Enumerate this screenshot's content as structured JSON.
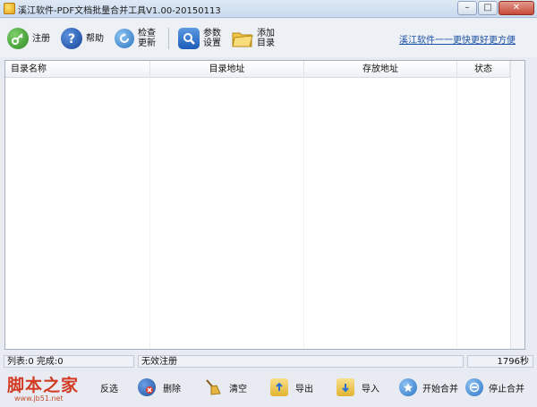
{
  "window": {
    "title": "溪江软件-PDF文档批量合并工具V1.00-20150113",
    "minimize_glyph": "–",
    "maximize_glyph": "□",
    "close_glyph": "✕"
  },
  "toolbar": {
    "buttons": [
      {
        "label": "注册",
        "icon": "key-icon"
      },
      {
        "label": "帮助",
        "icon": "help-icon"
      },
      {
        "label": "检查更新",
        "icon": "update-icon"
      },
      {
        "label": "参数设置",
        "icon": "settings-icon"
      },
      {
        "label": "添加目录",
        "icon": "folder-icon"
      }
    ],
    "link": "溪江软件一一更快更好更方便"
  },
  "table": {
    "columns": [
      "目录名称",
      "目录地址",
      "存放地址",
      "状态"
    ],
    "rows": []
  },
  "status": {
    "counts": "列表:0 完成:0",
    "registration": "无效注册",
    "timer": "1796秒"
  },
  "bottom": {
    "buttons": [
      {
        "label": "反选",
        "icon": "invert-icon"
      },
      {
        "label": "删除",
        "icon": "delete-icon"
      },
      {
        "label": "清空",
        "icon": "broom-icon"
      },
      {
        "label": "导出",
        "icon": "export-icon"
      },
      {
        "label": "导入",
        "icon": "import-icon"
      },
      {
        "label": "开始合并",
        "icon": "start-icon"
      },
      {
        "label": "停止合并",
        "icon": "stop-icon"
      }
    ]
  },
  "watermark": {
    "text": "脚本之家",
    "url": "www.jb51.net"
  },
  "colors": {
    "accent_blue": "#1f63c4",
    "link_blue": "#1a4fa3",
    "watermark_red": "#d23a24"
  }
}
